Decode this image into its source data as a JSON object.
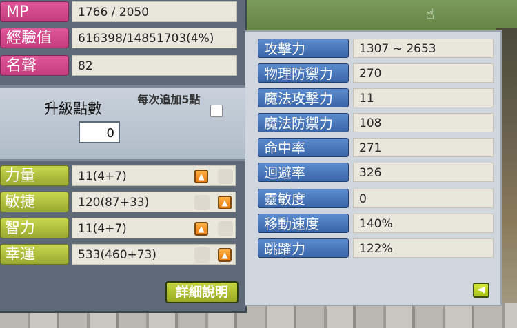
{
  "top_stats": [
    {
      "label": "MP",
      "value": "1766 / 2050"
    },
    {
      "label": "經驗值",
      "value": "616398/14851703(4%)"
    },
    {
      "label": "名聲",
      "value": "82"
    }
  ],
  "level_up": {
    "label": "升級點數",
    "points": "0",
    "per_click_label": "每次追加5點"
  },
  "abilities": [
    {
      "label": "力量",
      "value": "11(4+7)"
    },
    {
      "label": "敏捷",
      "value": "120(87+33)"
    },
    {
      "label": "智力",
      "value": "11(4+7)"
    },
    {
      "label": "幸運",
      "value": "533(460+73)"
    }
  ],
  "detail_button": "詳細說明",
  "detail_stats": [
    {
      "label": "攻擊力",
      "value": "1307 ~ 2653"
    },
    {
      "label": "物理防禦力",
      "value": "270"
    },
    {
      "label": "魔法攻擊力",
      "value": "11"
    },
    {
      "label": "魔法防禦力",
      "value": "108"
    },
    {
      "label": "命中率",
      "value": "271"
    },
    {
      "label": "迴避率",
      "value": "326"
    },
    {
      "label": "靈敏度",
      "value": "0"
    },
    {
      "label": "移動速度",
      "value": "140%"
    },
    {
      "label": "跳躍力",
      "value": "122%"
    }
  ],
  "icons": {
    "up": "arrow-up-icon",
    "back": "arrow-left-icon",
    "cursor": "hand-cursor-icon"
  }
}
